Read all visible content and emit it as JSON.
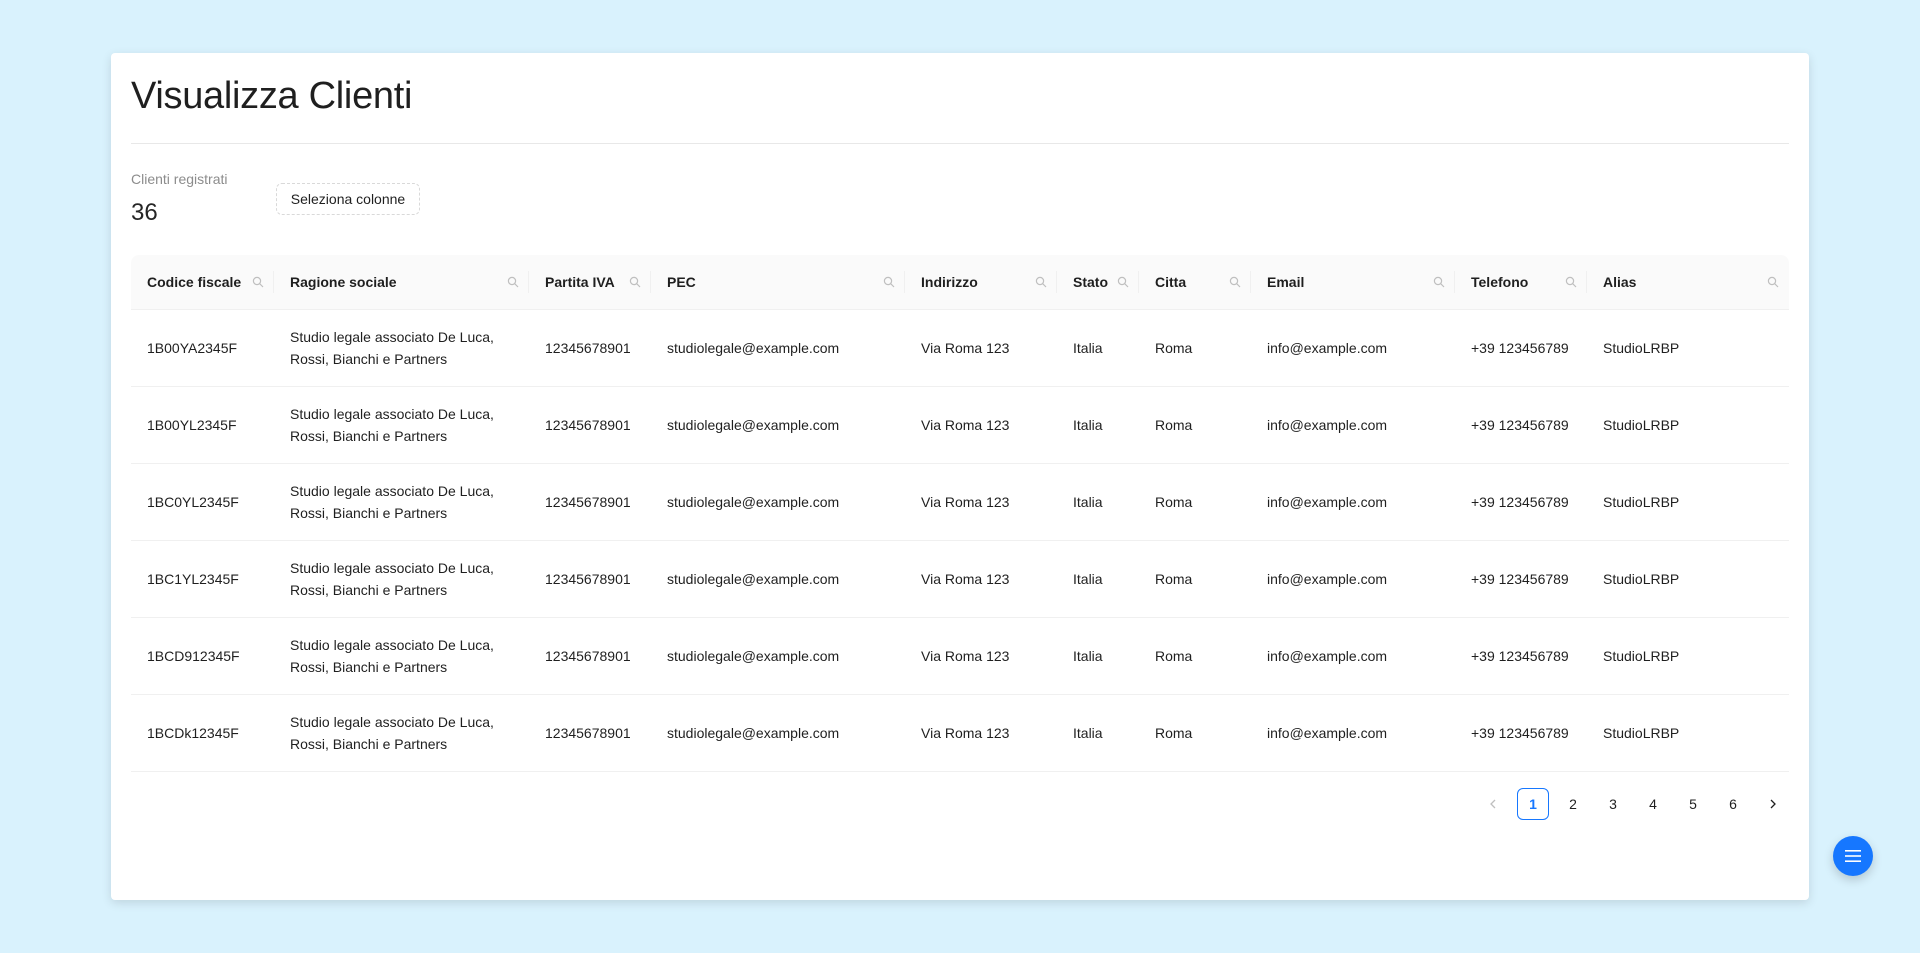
{
  "page": {
    "title": "Visualizza Clienti"
  },
  "stats": {
    "label": "Clienti registrati",
    "value": "36"
  },
  "toolbar": {
    "select_columns_label": "Seleziona colonne"
  },
  "table": {
    "columns": [
      "Codice fiscale",
      "Ragione sociale",
      "Partita IVA",
      "PEC",
      "Indirizzo",
      "Stato",
      "Citta",
      "Email",
      "Telefono",
      "Alias"
    ],
    "rows": [
      [
        "1B00YA2345F",
        "Studio legale associato De Luca, Rossi, Bianchi e Partners",
        "12345678901",
        "studiolegale@example.com",
        "Via Roma 123",
        "Italia",
        "Roma",
        "info@example.com",
        "+39 123456789",
        "StudioLRBP"
      ],
      [
        "1B00YL2345F",
        "Studio legale associato De Luca, Rossi, Bianchi e Partners",
        "12345678901",
        "studiolegale@example.com",
        "Via Roma 123",
        "Italia",
        "Roma",
        "info@example.com",
        "+39 123456789",
        "StudioLRBP"
      ],
      [
        "1BC0YL2345F",
        "Studio legale associato De Luca, Rossi, Bianchi e Partners",
        "12345678901",
        "studiolegale@example.com",
        "Via Roma 123",
        "Italia",
        "Roma",
        "info@example.com",
        "+39 123456789",
        "StudioLRBP"
      ],
      [
        "1BC1YL2345F",
        "Studio legale associato De Luca, Rossi, Bianchi e Partners",
        "12345678901",
        "studiolegale@example.com",
        "Via Roma 123",
        "Italia",
        "Roma",
        "info@example.com",
        "+39 123456789",
        "StudioLRBP"
      ],
      [
        "1BCD912345F",
        "Studio legale associato De Luca, Rossi, Bianchi e Partners",
        "12345678901",
        "studiolegale@example.com",
        "Via Roma 123",
        "Italia",
        "Roma",
        "info@example.com",
        "+39 123456789",
        "StudioLRBP"
      ],
      [
        "1BCDk12345F",
        "Studio legale associato De Luca, Rossi, Bianchi e Partners",
        "12345678901",
        "studiolegale@example.com",
        "Via Roma 123",
        "Italia",
        "Roma",
        "info@example.com",
        "+39 123456789",
        "StudioLRBP"
      ]
    ]
  },
  "pagination": {
    "prev_icon": "chevron-left-icon",
    "next_icon": "chevron-right-icon",
    "pages": [
      "1",
      "2",
      "3",
      "4",
      "5",
      "6"
    ],
    "current": "1"
  },
  "fab": {
    "icon": "menu-icon"
  },
  "colors": {
    "background": "#d9f2fd",
    "accent": "#1677ff",
    "header_bg": "#fafafa"
  }
}
